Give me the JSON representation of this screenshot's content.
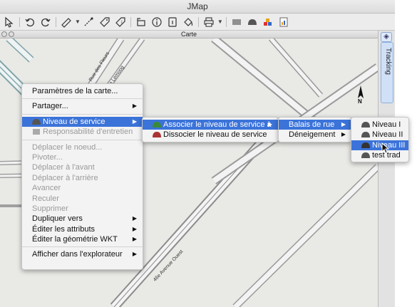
{
  "window": {
    "title": "JMap"
  },
  "toolbar": {
    "tools": [
      "select-arrow-icon",
      "undo-icon",
      "redo-icon",
      "ruler-icon",
      "measure-icon",
      "tag-icon",
      "info-tag-icon",
      "frame-icon",
      "info-icon",
      "document-icon",
      "paint-bucket-icon",
      "print-icon",
      "barcode-icon",
      "dome-icon",
      "layers-icon",
      "report-icon"
    ]
  },
  "panel": {
    "title": "Carte"
  },
  "side": {
    "tracking_label": "Tracking"
  },
  "map": {
    "north_label": "N",
    "streets": [
      "Rue des Fleurs",
      "Rue Lemoog",
      "46e Avenue Ouest"
    ]
  },
  "context_menu": {
    "items": [
      {
        "label": "Paramètres de la carte..."
      },
      {
        "label": "Partager..."
      },
      {
        "label": "Niveau de service"
      },
      {
        "label": "Responsabilité d'entretien"
      },
      {
        "label": "Déplacer le noeud..."
      },
      {
        "label": "Pivoter..."
      },
      {
        "label": "Déplacer à l'avant"
      },
      {
        "label": "Déplacer à l'arrière"
      },
      {
        "label": "Avancer"
      },
      {
        "label": "Reculer"
      },
      {
        "label": "Supprimer"
      },
      {
        "label": "Dupliquer vers"
      },
      {
        "label": "Éditer les attributs"
      },
      {
        "label": "Éditer la géométrie WKT"
      },
      {
        "label": "Afficher dans l'explorateur"
      }
    ]
  },
  "submenu_service": {
    "items": [
      {
        "label": "Associer le niveau de service à"
      },
      {
        "label": "Dissocier le niveau de service"
      }
    ]
  },
  "submenu_type": {
    "items": [
      {
        "label": "Balais de rue"
      },
      {
        "label": "Déneigement"
      }
    ]
  },
  "submenu_levels": {
    "items": [
      {
        "label": "Niveau I"
      },
      {
        "label": "Niveau II"
      },
      {
        "label": "Niveau III"
      },
      {
        "label": "test trad"
      }
    ]
  }
}
